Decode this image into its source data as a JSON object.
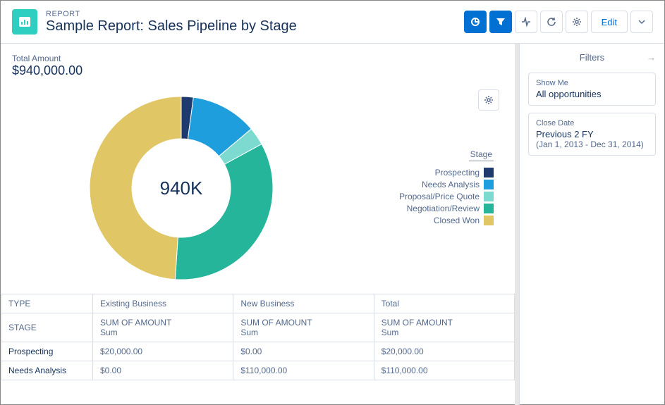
{
  "header": {
    "overline": "REPORT",
    "title": "Sample Report: Sales Pipeline by Stage",
    "edit_label": "Edit"
  },
  "total": {
    "label": "Total Amount",
    "value": "$940,000.00"
  },
  "chart_center": "940K",
  "legend_title": "Stage",
  "legend": [
    {
      "label": "Prospecting",
      "color": "#1f3a6f"
    },
    {
      "label": "Needs Analysis",
      "color": "#1f9ede"
    },
    {
      "label": "Proposal/Price Quote",
      "color": "#7ddad0"
    },
    {
      "label": "Negotiation/Review",
      "color": "#25b59a"
    },
    {
      "label": "Closed Won",
      "color": "#e0c665"
    }
  ],
  "chart_data": {
    "type": "pie",
    "title": "Sales Pipeline by Stage",
    "total": 940000,
    "categories": [
      "Prospecting",
      "Needs Analysis",
      "Proposal/Price Quote",
      "Negotiation/Review",
      "Closed Won"
    ],
    "values": [
      20000,
      110000,
      30000,
      320000,
      460000
    ],
    "colors": [
      "#1f3a6f",
      "#1f9ede",
      "#7ddad0",
      "#25b59a",
      "#e0c665"
    ]
  },
  "table": {
    "type_header": "TYPE",
    "stage_header": "STAGE",
    "measure_label": "SUM OF AMOUNT",
    "measure_sub": "Sum",
    "columns": [
      "Existing Business",
      "New Business",
      "Total"
    ],
    "rows": [
      {
        "label": "Prospecting",
        "cells": [
          "$20,000.00",
          "$0.00",
          "$20,000.00"
        ]
      },
      {
        "label": "Needs Analysis",
        "cells": [
          "$0.00",
          "$110,000.00",
          "$110,000.00"
        ]
      }
    ]
  },
  "filters": {
    "title": "Filters",
    "show_me_label": "Show Me",
    "show_me_value": "All opportunities",
    "close_date_label": "Close Date",
    "close_date_value": "Previous 2 FY",
    "close_date_range": "(Jan 1, 2013 - Dec 31, 2014)"
  }
}
